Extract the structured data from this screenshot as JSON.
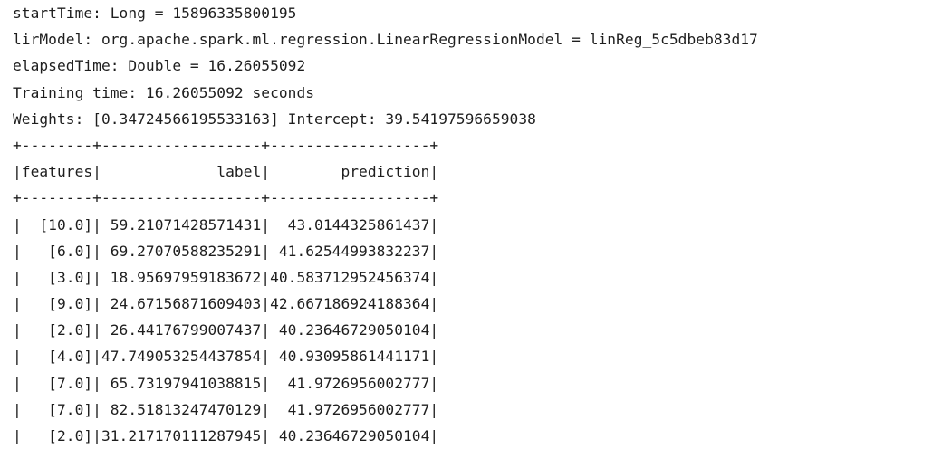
{
  "console": {
    "lines": [
      "startTime: Long = 15896335800195",
      "lirModel: org.apache.spark.ml.regression.LinearRegressionModel = linReg_5c5dbeb83d17",
      "elapsedTime: Double = 16.26055092",
      "Training time: 16.26055092 seconds",
      "Weights: [0.34724566195533163] Intercept: 39.54197596659038"
    ],
    "table": {
      "border": "+--------+------------------+------------------+",
      "header": "|features|             label|        prediction|",
      "rows": [
        "|  [10.0]| 59.21071428571431|  43.0144325861437|",
        "|   [6.0]| 69.27070588235291| 41.62544993832237|",
        "|   [3.0]| 18.95697959183672|40.583712952456374|",
        "|   [9.0]| 24.67156871609403|42.667186924188364|",
        "|   [2.0]| 26.44176799007437| 40.23646729050104|",
        "|   [4.0]|47.749053254437854| 40.93095861441171|",
        "|   [7.0]| 65.73197941038815|  41.9726956002777|",
        "|   [7.0]| 82.51813247470129|  41.9726956002777|",
        "|   [2.0]|31.217170111287945| 40.23646729050104|"
      ]
    }
  }
}
